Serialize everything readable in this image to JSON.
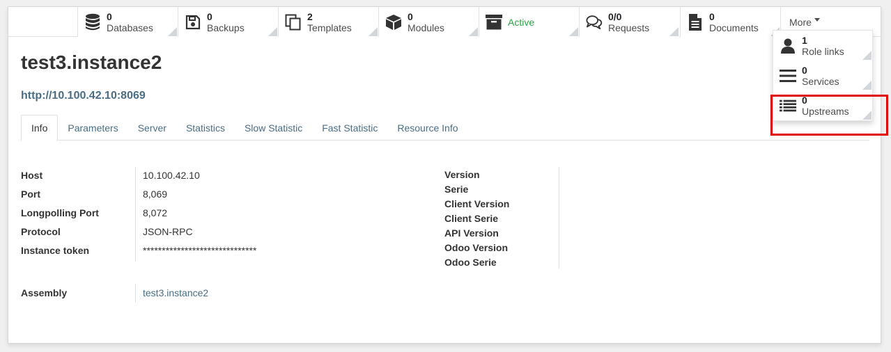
{
  "smart_buttons": [
    {
      "icon": "database-icon",
      "count": "0",
      "label": "Databases"
    },
    {
      "icon": "floppy-disk-icon",
      "count": "0",
      "label": "Backups"
    },
    {
      "icon": "copy-icon",
      "count": "2",
      "label": "Templates"
    },
    {
      "icon": "cube-icon",
      "count": "0",
      "label": "Modules"
    },
    {
      "icon": "archive-icon",
      "status": "Active"
    },
    {
      "icon": "comments-icon",
      "count": "0/0",
      "label": "Requests"
    },
    {
      "icon": "file-text-icon",
      "count": "0",
      "label": "Documents"
    }
  ],
  "more": {
    "label": "More"
  },
  "dropdown": [
    {
      "icon": "user-icon",
      "count": "1",
      "label": "Role links"
    },
    {
      "icon": "bars-icon",
      "count": "0",
      "label": "Services"
    },
    {
      "icon": "list-icon",
      "count": "0",
      "label": "Upstreams"
    }
  ],
  "record": {
    "title": "test3.instance2",
    "url": "http://10.100.42.10:8069"
  },
  "tabs": [
    "Info",
    "Parameters",
    "Server",
    "Statistics",
    "Slow Statistic",
    "Fast Statistic",
    "Resource Info"
  ],
  "fields_left": [
    {
      "label": "Host",
      "value": "10.100.42.10"
    },
    {
      "label": "Port",
      "value": "8,069"
    },
    {
      "label": "Longpolling Port",
      "value": "8,072"
    },
    {
      "label": "Protocol",
      "value": "JSON-RPC"
    },
    {
      "label": "Instance token",
      "value": "******************************"
    }
  ],
  "fields_right": [
    {
      "label": "Version",
      "value": ""
    },
    {
      "label": "Serie",
      "value": ""
    },
    {
      "label": "Client Version",
      "value": ""
    },
    {
      "label": "Client Serie",
      "value": ""
    },
    {
      "label": "API Version",
      "value": ""
    },
    {
      "label": "Odoo Version",
      "value": ""
    },
    {
      "label": "Odoo Serie",
      "value": ""
    }
  ],
  "assembly": {
    "label": "Assembly",
    "value": "test3.instance2"
  },
  "colors": {
    "accent_link": "#4a6d84",
    "active_status": "#28a745",
    "highlight": "#e00000"
  }
}
